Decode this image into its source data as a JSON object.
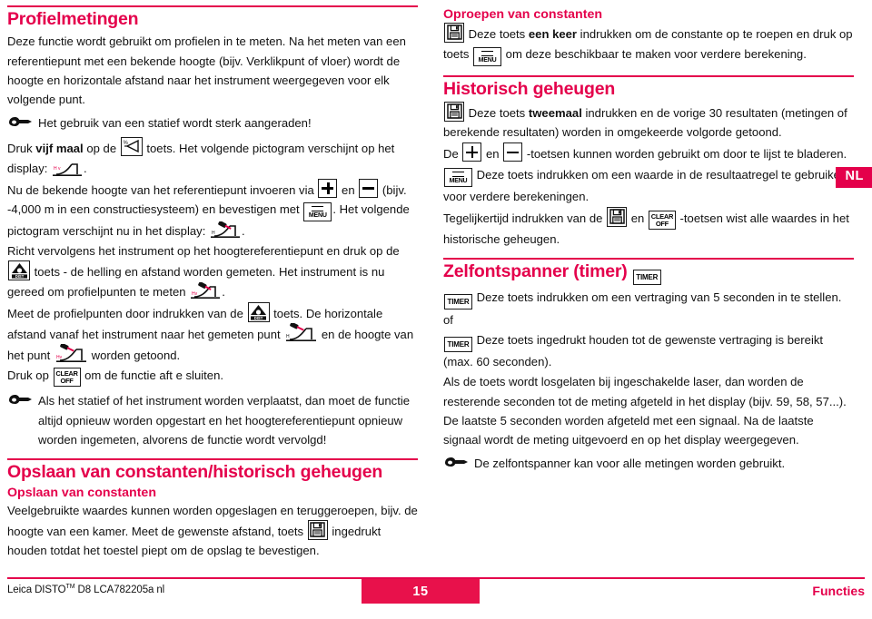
{
  "meta": {
    "accent_color": "#E4004B",
    "page_tab_color": "#E8114B",
    "language_tab": "NL"
  },
  "left_column": {
    "heading": "Profielmetingen",
    "paragraphs": {
      "intro": "Deze functie wordt gebruikt om profielen in te meten. Na het meten van een referentiepunt met een bekende hoogte (bijv. Verklikpunt of vloer) wordt de hoogte en horizontale afstand naar het instrument weergegeven voor elk volgende punt.",
      "tripod_note": "Het gebruik van een statief wordt sterk aangeraden!",
      "press_five_1": "Druk ",
      "press_five_bold": "vijf maal",
      "press_five_2": " op de ",
      "press_five_3": " toets. Het volgende pictogram verschijnt op het display: ",
      "press_five_4": ".",
      "enter_height_1": "Nu de bekende hoogte van het referentiepunt invoeren via ",
      "enter_height_2": " en ",
      "enter_height_3": " (bijv. -4,000 m in een constructiesysteem) en bevestigen met ",
      "enter_height_4": ". Het volgende pictogram verschijnt nu in het display: ",
      "enter_height_5": ".",
      "aim_1": "Richt vervolgens het instrument op het hoogtereferentiepunt en druk op de ",
      "aim_2": " toets - de helling en afstand worden gemeten. Het instrument is nu gereed om profielpunten te meten ",
      "aim_3": ".",
      "measure_1": "Meet de profielpunten door indrukken van de ",
      "measure_2": " toets. De horizontale afstand vanaf het instrument naar het gemeten punt ",
      "measure_3": " en de hoogte van het punt ",
      "measure_4": " worden getoond.",
      "exit_1": "Druk op ",
      "exit_2": " om de functie aft e sluiten.",
      "move_note": "Als het statief of het instrument worden verplaatst, dan moet de functie altijd opnieuw worden opgestart en het hoogtereferentiepunt opnieuw worden ingemeten, alvorens de functie wordt vervolgd!"
    },
    "section2": {
      "heading": "Opslaan van constanten/historisch geheugen",
      "subheading": "Opslaan van constanten",
      "text_1": "Veelgebruikte waardes kunnen worden opgeslagen en teruggeroepen, bijv. de hoogte van een kamer. Meet de gewenste afstand, toets ",
      "text_2": " ingedrukt houden totdat het toestel piept om de opslag te bevestigen."
    }
  },
  "right_column": {
    "recall": {
      "subheading": "Oproepen van constanten",
      "text_1": "Deze toets ",
      "text_bold": "een keer",
      "text_2": " indrukken om de constante op te roepen en druk op toets ",
      "text_3": " om deze beschikbaar te maken voor verdere berekening."
    },
    "history": {
      "heading": "Historisch geheugen",
      "p1_1": "Deze toets ",
      "p1_bold": "tweemaal",
      "p1_2": " indrukken en de vorige 30 resultaten (metingen of berekende resultaten) worden in omgekeerde volgorde getoond.",
      "p2_1": "De ",
      "p2_2": " en ",
      "p2_3": " -toetsen kunnen worden gebruikt om door te lijst te bladeren.",
      "p3_1": "Deze toets indrukken om een waarde in de resultaatregel te gebruiken voor verdere berekeningen.",
      "p4_1": "Tegelijkertijd indrukken van de ",
      "p4_2": " en ",
      "p4_3": " -toetsen wist alle waardes in het historische geheugen."
    },
    "timer": {
      "heading": "Zelfontspanner (timer)",
      "p1": "Deze toets indrukken om een vertraging van 5 seconden in te stellen.",
      "or": "of",
      "p2": "Deze toets ingedrukt houden tot de gewenste vertraging is bereikt (max. 60 seconden).",
      "p3": "Als de toets wordt losgelaten bij ingeschakelde laser, dan worden de resterende seconden tot de meting afgeteld in het display (bijv. 59, 58, 57...). De laatste 5 seconden worden afgeteld met een signaal. Na de laatste signaal wordt de meting uitgevoerd en op het display weergegeven.",
      "note": "De zelfontspanner kan voor alle metingen worden gebruikt."
    }
  },
  "footer": {
    "left_pre": "Leica DISTO",
    "left_tm": "TM",
    "left_post": " D8 LCA782205a nl",
    "page_number": "15",
    "right": "Functies"
  },
  "keys": {
    "menu_label": "MENU",
    "clear_line1": "CLEAR",
    "clear_line2": "OFF",
    "timer_label": "TIMER",
    "dist_label": "DIST"
  }
}
